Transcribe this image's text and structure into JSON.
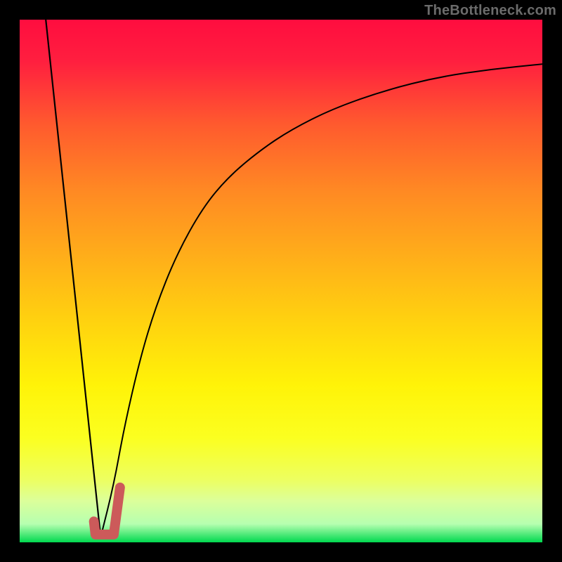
{
  "watermark": "TheBottleneck.com",
  "colors": {
    "black": "#000000",
    "curve": "#000000",
    "marker": "#cc5a5a",
    "green_band_top": "#8aff4a",
    "green_band_bottom": "#00d94f",
    "gradient_stops": [
      {
        "offset": 0.0,
        "color": "#ff0d3f"
      },
      {
        "offset": 0.08,
        "color": "#ff1f3f"
      },
      {
        "offset": 0.2,
        "color": "#ff5a2e"
      },
      {
        "offset": 0.33,
        "color": "#ff8a23"
      },
      {
        "offset": 0.46,
        "color": "#ffb019"
      },
      {
        "offset": 0.58,
        "color": "#ffd30f"
      },
      {
        "offset": 0.7,
        "color": "#fff308"
      },
      {
        "offset": 0.8,
        "color": "#fbff20"
      },
      {
        "offset": 0.88,
        "color": "#edff60"
      },
      {
        "offset": 0.92,
        "color": "#dcff9a"
      },
      {
        "offset": 0.965,
        "color": "#b6ffb0"
      },
      {
        "offset": 1.0,
        "color": "#00d94f"
      }
    ]
  },
  "chart_data": {
    "type": "line",
    "title": "",
    "xlabel": "",
    "ylabel": "",
    "xlim": [
      0,
      100
    ],
    "ylim": [
      0,
      100
    ],
    "series": [
      {
        "name": "left-descending-line",
        "x": [
          5,
          15.5
        ],
        "values": [
          100,
          1
        ]
      },
      {
        "name": "right-rising-curve",
        "x": [
          15.5,
          18,
          20,
          23,
          26,
          30,
          35,
          40,
          46,
          52,
          60,
          70,
          80,
          90,
          100
        ],
        "values": [
          1,
          11,
          22,
          35,
          45,
          55,
          64,
          70,
          75,
          79,
          83,
          86.5,
          89,
          90.5,
          91.5
        ]
      }
    ],
    "marker": {
      "name": "j-shaped-highlight",
      "points_xy": [
        [
          14.2,
          4.0
        ],
        [
          14.5,
          1.5
        ],
        [
          18.0,
          1.5
        ],
        [
          19.2,
          10.5
        ]
      ],
      "stroke_width_px": 14
    },
    "green_band": {
      "y_top": 3.5,
      "y_bottom": 0
    }
  }
}
